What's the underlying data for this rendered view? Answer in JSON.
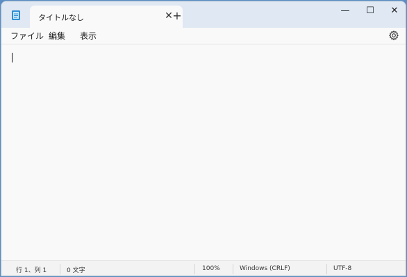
{
  "tab": {
    "title": "タイトルなし",
    "close_glyph": "✕"
  },
  "new_tab_glyph": "+",
  "window_buttons": {
    "minimize": "—",
    "maximize": "☐",
    "close": "✕"
  },
  "menu": {
    "file": "ファイル",
    "edit": "編集",
    "view": "表示"
  },
  "status": {
    "position": "行 1、列 1",
    "chars": "0 文字",
    "zoom": "100%",
    "line_ending": "Windows (CRLF)",
    "encoding": "UTF-8"
  },
  "icons": {
    "app": "notepad-icon",
    "settings": "gear-icon"
  },
  "colors": {
    "titlebar": "#dfe8f3",
    "editor": "#f9f9f9",
    "icon_accent": "#2d8fd5"
  }
}
